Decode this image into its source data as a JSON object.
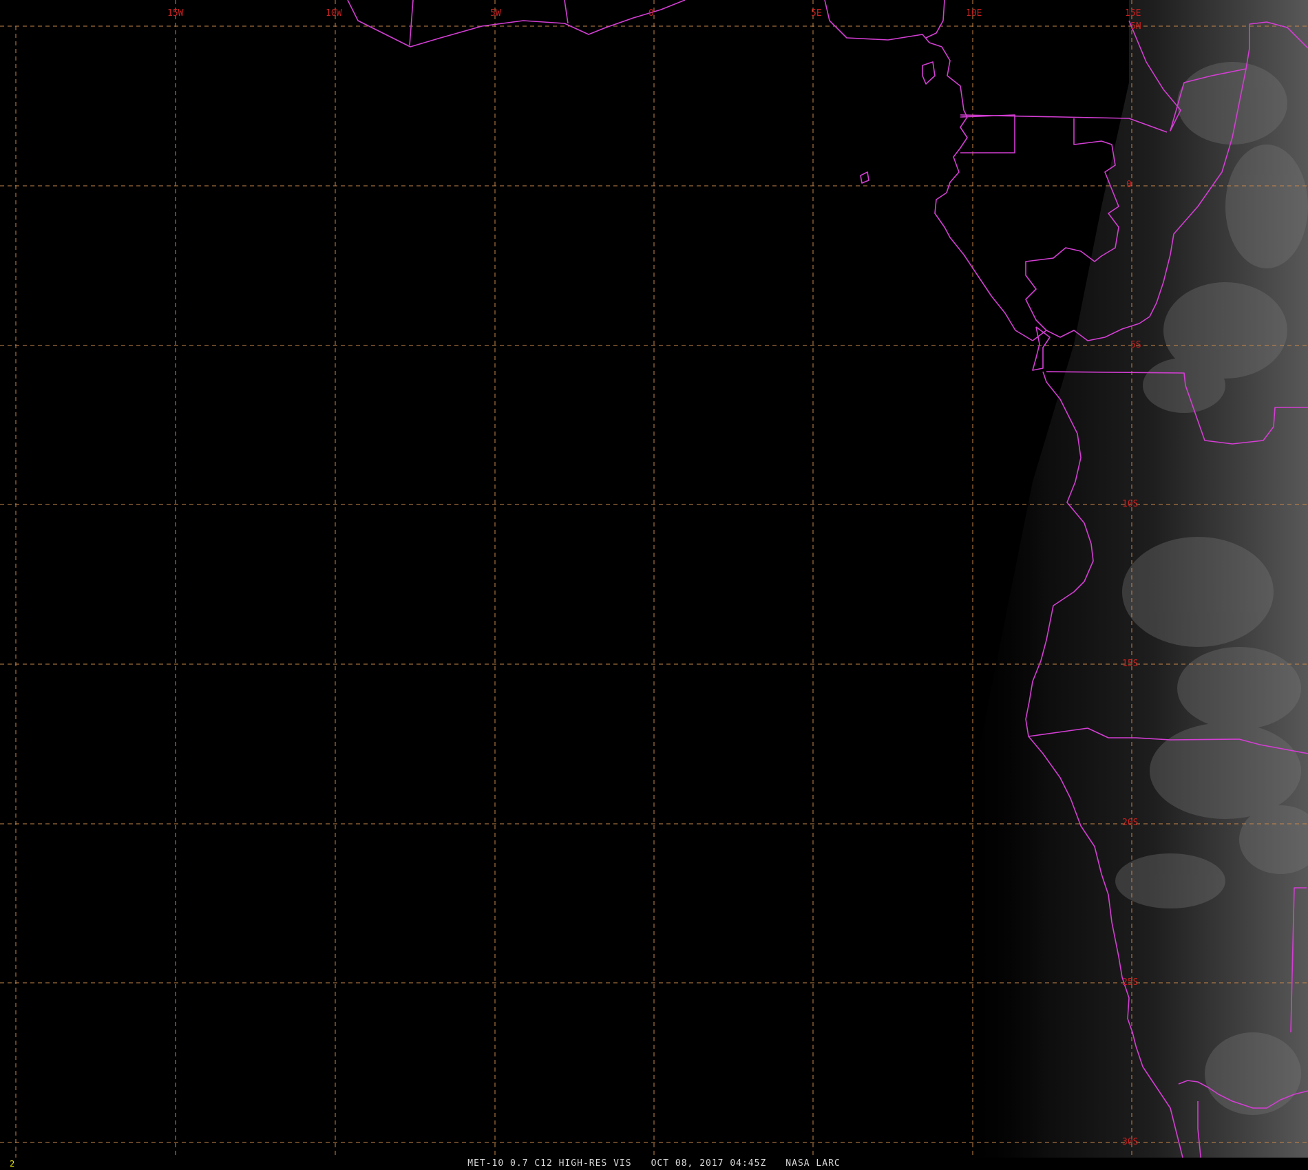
{
  "map": {
    "projection": "lat-lon grid",
    "grid_color": "#c8874a",
    "label_color": "#c82020",
    "boundary_color": "#d33ed3",
    "lon_labels": [
      "15W",
      "10W",
      "5W",
      "0",
      "5E",
      "10E",
      "15E"
    ],
    "lat_labels": [
      "5N",
      "0",
      "5S",
      "10S",
      "15S",
      "20S",
      "25S",
      "30S"
    ]
  },
  "status": {
    "frame_number": "2",
    "satellite_product": "MET-10 0.7 C12 HIGH-RES VIS",
    "datetime": "OCT 08, 2017 04:45Z",
    "source": "NASA LARC"
  }
}
